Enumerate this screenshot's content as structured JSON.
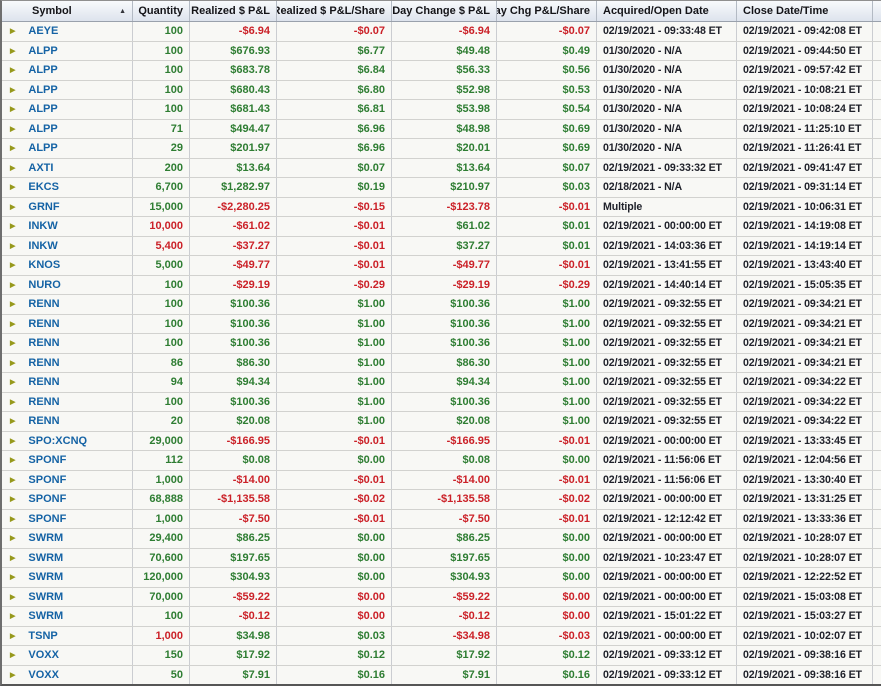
{
  "colors": {
    "positive": "#2e7d32",
    "negative": "#cb2128",
    "symbol_blue": "#1563a5",
    "date_text": "#20222b",
    "expand_icon": "#97991c",
    "header_gradient_top": "#f8fafc",
    "header_gradient_bottom": "#dde3ed"
  },
  "icons": {
    "expand": "▶",
    "sort_asc": "▲"
  },
  "table": {
    "sort": {
      "column": "Symbol",
      "direction": "ascending"
    },
    "columns": [
      {
        "label": "Symbol",
        "align": "left",
        "sorted": true
      },
      {
        "label": "Quantity",
        "align": "right"
      },
      {
        "label": "Realized $ P&L",
        "align": "right"
      },
      {
        "label": "Realized $ P&L/Share",
        "align": "right"
      },
      {
        "label": "Day Change $ P&L",
        "align": "right"
      },
      {
        "label": "Day Chg P&L/Share",
        "align": "right"
      },
      {
        "label": "Acquired/Open Date",
        "align": "left"
      },
      {
        "label": "Close Date/Time",
        "align": "left"
      },
      {
        "label": "",
        "align": "left"
      }
    ],
    "rows": [
      {
        "symbol": "AEYE",
        "qty": "100",
        "qty_c": "pos",
        "rpl": "-$6.94",
        "rpl_c": "neg",
        "rps": "-$0.07",
        "rps_c": "neg",
        "dcp": "-$6.94",
        "dcp_c": "neg",
        "dcs": "-$0.07",
        "dcs_c": "neg",
        "acq": "02/19/2021 - 09:33:48 ET",
        "close": "02/19/2021 - 09:42:08 ET"
      },
      {
        "symbol": "ALPP",
        "qty": "100",
        "qty_c": "pos",
        "rpl": "$676.93",
        "rpl_c": "pos",
        "rps": "$6.77",
        "rps_c": "pos",
        "dcp": "$49.48",
        "dcp_c": "pos",
        "dcs": "$0.49",
        "dcs_c": "pos",
        "acq": "01/30/2020 - N/A",
        "close": "02/19/2021 - 09:44:50 ET"
      },
      {
        "symbol": "ALPP",
        "qty": "100",
        "qty_c": "pos",
        "rpl": "$683.78",
        "rpl_c": "pos",
        "rps": "$6.84",
        "rps_c": "pos",
        "dcp": "$56.33",
        "dcp_c": "pos",
        "dcs": "$0.56",
        "dcs_c": "pos",
        "acq": "01/30/2020 - N/A",
        "close": "02/19/2021 - 09:57:42 ET"
      },
      {
        "symbol": "ALPP",
        "qty": "100",
        "qty_c": "pos",
        "rpl": "$680.43",
        "rpl_c": "pos",
        "rps": "$6.80",
        "rps_c": "pos",
        "dcp": "$52.98",
        "dcp_c": "pos",
        "dcs": "$0.53",
        "dcs_c": "pos",
        "acq": "01/30/2020 - N/A",
        "close": "02/19/2021 - 10:08:21 ET"
      },
      {
        "symbol": "ALPP",
        "qty": "100",
        "qty_c": "pos",
        "rpl": "$681.43",
        "rpl_c": "pos",
        "rps": "$6.81",
        "rps_c": "pos",
        "dcp": "$53.98",
        "dcp_c": "pos",
        "dcs": "$0.54",
        "dcs_c": "pos",
        "acq": "01/30/2020 - N/A",
        "close": "02/19/2021 - 10:08:24 ET"
      },
      {
        "symbol": "ALPP",
        "qty": "71",
        "qty_c": "pos",
        "rpl": "$494.47",
        "rpl_c": "pos",
        "rps": "$6.96",
        "rps_c": "pos",
        "dcp": "$48.98",
        "dcp_c": "pos",
        "dcs": "$0.69",
        "dcs_c": "pos",
        "acq": "01/30/2020 - N/A",
        "close": "02/19/2021 - 11:25:10 ET"
      },
      {
        "symbol": "ALPP",
        "qty": "29",
        "qty_c": "pos",
        "rpl": "$201.97",
        "rpl_c": "pos",
        "rps": "$6.96",
        "rps_c": "pos",
        "dcp": "$20.01",
        "dcp_c": "pos",
        "dcs": "$0.69",
        "dcs_c": "pos",
        "acq": "01/30/2020 - N/A",
        "close": "02/19/2021 - 11:26:41 ET"
      },
      {
        "symbol": "AXTI",
        "qty": "200",
        "qty_c": "pos",
        "rpl": "$13.64",
        "rpl_c": "pos",
        "rps": "$0.07",
        "rps_c": "pos",
        "dcp": "$13.64",
        "dcp_c": "pos",
        "dcs": "$0.07",
        "dcs_c": "pos",
        "acq": "02/19/2021 - 09:33:32 ET",
        "close": "02/19/2021 - 09:41:47 ET"
      },
      {
        "symbol": "EKCS",
        "qty": "6,700",
        "qty_c": "pos",
        "rpl": "$1,282.97",
        "rpl_c": "pos",
        "rps": "$0.19",
        "rps_c": "pos",
        "dcp": "$210.97",
        "dcp_c": "pos",
        "dcs": "$0.03",
        "dcs_c": "pos",
        "acq": "02/18/2021 - N/A",
        "close": "02/19/2021 - 09:31:14 ET"
      },
      {
        "symbol": "GRNF",
        "qty": "15,000",
        "qty_c": "pos",
        "rpl": "-$2,280.25",
        "rpl_c": "neg",
        "rps": "-$0.15",
        "rps_c": "neg",
        "dcp": "-$123.78",
        "dcp_c": "neg",
        "dcs": "-$0.01",
        "dcs_c": "neg",
        "acq": "Multiple",
        "close": "02/19/2021 - 10:06:31 ET"
      },
      {
        "symbol": "INKW",
        "qty": "10,000",
        "qty_c": "neg",
        "rpl": "-$61.02",
        "rpl_c": "neg",
        "rps": "-$0.01",
        "rps_c": "neg",
        "dcp": "$61.02",
        "dcp_c": "pos",
        "dcs": "$0.01",
        "dcs_c": "pos",
        "acq": "02/19/2021 - 00:00:00 ET",
        "close": "02/19/2021 - 14:19:08 ET"
      },
      {
        "symbol": "INKW",
        "qty": "5,400",
        "qty_c": "neg",
        "rpl": "-$37.27",
        "rpl_c": "neg",
        "rps": "-$0.01",
        "rps_c": "neg",
        "dcp": "$37.27",
        "dcp_c": "pos",
        "dcs": "$0.01",
        "dcs_c": "pos",
        "acq": "02/19/2021 - 14:03:36 ET",
        "close": "02/19/2021 - 14:19:14 ET"
      },
      {
        "symbol": "KNOS",
        "qty": "5,000",
        "qty_c": "pos",
        "rpl": "-$49.77",
        "rpl_c": "neg",
        "rps": "-$0.01",
        "rps_c": "neg",
        "dcp": "-$49.77",
        "dcp_c": "neg",
        "dcs": "-$0.01",
        "dcs_c": "neg",
        "acq": "02/19/2021 - 13:41:55 ET",
        "close": "02/19/2021 - 13:43:40 ET"
      },
      {
        "symbol": "NURO",
        "qty": "100",
        "qty_c": "pos",
        "rpl": "-$29.19",
        "rpl_c": "neg",
        "rps": "-$0.29",
        "rps_c": "neg",
        "dcp": "-$29.19",
        "dcp_c": "neg",
        "dcs": "-$0.29",
        "dcs_c": "neg",
        "acq": "02/19/2021 - 14:40:14 ET",
        "close": "02/19/2021 - 15:05:35 ET"
      },
      {
        "symbol": "RENN",
        "qty": "100",
        "qty_c": "pos",
        "rpl": "$100.36",
        "rpl_c": "pos",
        "rps": "$1.00",
        "rps_c": "pos",
        "dcp": "$100.36",
        "dcp_c": "pos",
        "dcs": "$1.00",
        "dcs_c": "pos",
        "acq": "02/19/2021 - 09:32:55 ET",
        "close": "02/19/2021 - 09:34:21 ET"
      },
      {
        "symbol": "RENN",
        "qty": "100",
        "qty_c": "pos",
        "rpl": "$100.36",
        "rpl_c": "pos",
        "rps": "$1.00",
        "rps_c": "pos",
        "dcp": "$100.36",
        "dcp_c": "pos",
        "dcs": "$1.00",
        "dcs_c": "pos",
        "acq": "02/19/2021 - 09:32:55 ET",
        "close": "02/19/2021 - 09:34:21 ET"
      },
      {
        "symbol": "RENN",
        "qty": "100",
        "qty_c": "pos",
        "rpl": "$100.36",
        "rpl_c": "pos",
        "rps": "$1.00",
        "rps_c": "pos",
        "dcp": "$100.36",
        "dcp_c": "pos",
        "dcs": "$1.00",
        "dcs_c": "pos",
        "acq": "02/19/2021 - 09:32:55 ET",
        "close": "02/19/2021 - 09:34:21 ET"
      },
      {
        "symbol": "RENN",
        "qty": "86",
        "qty_c": "pos",
        "rpl": "$86.30",
        "rpl_c": "pos",
        "rps": "$1.00",
        "rps_c": "pos",
        "dcp": "$86.30",
        "dcp_c": "pos",
        "dcs": "$1.00",
        "dcs_c": "pos",
        "acq": "02/19/2021 - 09:32:55 ET",
        "close": "02/19/2021 - 09:34:21 ET"
      },
      {
        "symbol": "RENN",
        "qty": "94",
        "qty_c": "pos",
        "rpl": "$94.34",
        "rpl_c": "pos",
        "rps": "$1.00",
        "rps_c": "pos",
        "dcp": "$94.34",
        "dcp_c": "pos",
        "dcs": "$1.00",
        "dcs_c": "pos",
        "acq": "02/19/2021 - 09:32:55 ET",
        "close": "02/19/2021 - 09:34:22 ET"
      },
      {
        "symbol": "RENN",
        "qty": "100",
        "qty_c": "pos",
        "rpl": "$100.36",
        "rpl_c": "pos",
        "rps": "$1.00",
        "rps_c": "pos",
        "dcp": "$100.36",
        "dcp_c": "pos",
        "dcs": "$1.00",
        "dcs_c": "pos",
        "acq": "02/19/2021 - 09:32:55 ET",
        "close": "02/19/2021 - 09:34:22 ET"
      },
      {
        "symbol": "RENN",
        "qty": "20",
        "qty_c": "pos",
        "rpl": "$20.08",
        "rpl_c": "pos",
        "rps": "$1.00",
        "rps_c": "pos",
        "dcp": "$20.08",
        "dcp_c": "pos",
        "dcs": "$1.00",
        "dcs_c": "pos",
        "acq": "02/19/2021 - 09:32:55 ET",
        "close": "02/19/2021 - 09:34:22 ET"
      },
      {
        "symbol": "SPO:XCNQ",
        "qty": "29,000",
        "qty_c": "pos",
        "rpl": "-$166.95",
        "rpl_c": "neg",
        "rps": "-$0.01",
        "rps_c": "neg",
        "dcp": "-$166.95",
        "dcp_c": "neg",
        "dcs": "-$0.01",
        "dcs_c": "neg",
        "acq": "02/19/2021 - 00:00:00 ET",
        "close": "02/19/2021 - 13:33:45 ET"
      },
      {
        "symbol": "SPONF",
        "qty": "112",
        "qty_c": "pos",
        "rpl": "$0.08",
        "rpl_c": "pos",
        "rps": "$0.00",
        "rps_c": "pos",
        "dcp": "$0.08",
        "dcp_c": "pos",
        "dcs": "$0.00",
        "dcs_c": "pos",
        "acq": "02/19/2021 - 11:56:06 ET",
        "close": "02/19/2021 - 12:04:56 ET"
      },
      {
        "symbol": "SPONF",
        "qty": "1,000",
        "qty_c": "pos",
        "rpl": "-$14.00",
        "rpl_c": "neg",
        "rps": "-$0.01",
        "rps_c": "neg",
        "dcp": "-$14.00",
        "dcp_c": "neg",
        "dcs": "-$0.01",
        "dcs_c": "neg",
        "acq": "02/19/2021 - 11:56:06 ET",
        "close": "02/19/2021 - 13:30:40 ET"
      },
      {
        "symbol": "SPONF",
        "qty": "68,888",
        "qty_c": "pos",
        "rpl": "-$1,135.58",
        "rpl_c": "neg",
        "rps": "-$0.02",
        "rps_c": "neg",
        "dcp": "-$1,135.58",
        "dcp_c": "neg",
        "dcs": "-$0.02",
        "dcs_c": "neg",
        "acq": "02/19/2021 - 00:00:00 ET",
        "close": "02/19/2021 - 13:31:25 ET"
      },
      {
        "symbol": "SPONF",
        "qty": "1,000",
        "qty_c": "pos",
        "rpl": "-$7.50",
        "rpl_c": "neg",
        "rps": "-$0.01",
        "rps_c": "neg",
        "dcp": "-$7.50",
        "dcp_c": "neg",
        "dcs": "-$0.01",
        "dcs_c": "neg",
        "acq": "02/19/2021 - 12:12:42 ET",
        "close": "02/19/2021 - 13:33:36 ET"
      },
      {
        "symbol": "SWRM",
        "qty": "29,400",
        "qty_c": "pos",
        "rpl": "$86.25",
        "rpl_c": "pos",
        "rps": "$0.00",
        "rps_c": "pos",
        "dcp": "$86.25",
        "dcp_c": "pos",
        "dcs": "$0.00",
        "dcs_c": "pos",
        "acq": "02/19/2021 - 00:00:00 ET",
        "close": "02/19/2021 - 10:28:07 ET"
      },
      {
        "symbol": "SWRM",
        "qty": "70,600",
        "qty_c": "pos",
        "rpl": "$197.65",
        "rpl_c": "pos",
        "rps": "$0.00",
        "rps_c": "pos",
        "dcp": "$197.65",
        "dcp_c": "pos",
        "dcs": "$0.00",
        "dcs_c": "pos",
        "acq": "02/19/2021 - 10:23:47 ET",
        "close": "02/19/2021 - 10:28:07 ET"
      },
      {
        "symbol": "SWRM",
        "qty": "120,000",
        "qty_c": "pos",
        "rpl": "$304.93",
        "rpl_c": "pos",
        "rps": "$0.00",
        "rps_c": "pos",
        "dcp": "$304.93",
        "dcp_c": "pos",
        "dcs": "$0.00",
        "dcs_c": "pos",
        "acq": "02/19/2021 - 00:00:00 ET",
        "close": "02/19/2021 - 12:22:52 ET"
      },
      {
        "symbol": "SWRM",
        "qty": "70,000",
        "qty_c": "pos",
        "rpl": "-$59.22",
        "rpl_c": "neg",
        "rps": "$0.00",
        "rps_c": "neg",
        "dcp": "-$59.22",
        "dcp_c": "neg",
        "dcs": "$0.00",
        "dcs_c": "neg",
        "acq": "02/19/2021 - 00:00:00 ET",
        "close": "02/19/2021 - 15:03:08 ET"
      },
      {
        "symbol": "SWRM",
        "qty": "100",
        "qty_c": "pos",
        "rpl": "-$0.12",
        "rpl_c": "neg",
        "rps": "$0.00",
        "rps_c": "neg",
        "dcp": "-$0.12",
        "dcp_c": "neg",
        "dcs": "$0.00",
        "dcs_c": "neg",
        "acq": "02/19/2021 - 15:01:22 ET",
        "close": "02/19/2021 - 15:03:27 ET"
      },
      {
        "symbol": "TSNP",
        "qty": "1,000",
        "qty_c": "neg",
        "rpl": "$34.98",
        "rpl_c": "pos",
        "rps": "$0.03",
        "rps_c": "pos",
        "dcp": "-$34.98",
        "dcp_c": "neg",
        "dcs": "-$0.03",
        "dcs_c": "neg",
        "acq": "02/19/2021 - 00:00:00 ET",
        "close": "02/19/2021 - 10:02:07 ET"
      },
      {
        "symbol": "VOXX",
        "qty": "150",
        "qty_c": "pos",
        "rpl": "$17.92",
        "rpl_c": "pos",
        "rps": "$0.12",
        "rps_c": "pos",
        "dcp": "$17.92",
        "dcp_c": "pos",
        "dcs": "$0.12",
        "dcs_c": "pos",
        "acq": "02/19/2021 - 09:33:12 ET",
        "close": "02/19/2021 - 09:38:16 ET"
      },
      {
        "symbol": "VOXX",
        "qty": "50",
        "qty_c": "pos",
        "rpl": "$7.91",
        "rpl_c": "pos",
        "rps": "$0.16",
        "rps_c": "pos",
        "dcp": "$7.91",
        "dcp_c": "pos",
        "dcs": "$0.16",
        "dcs_c": "pos",
        "acq": "02/19/2021 - 09:33:12 ET",
        "close": "02/19/2021 - 09:38:16 ET"
      }
    ]
  }
}
